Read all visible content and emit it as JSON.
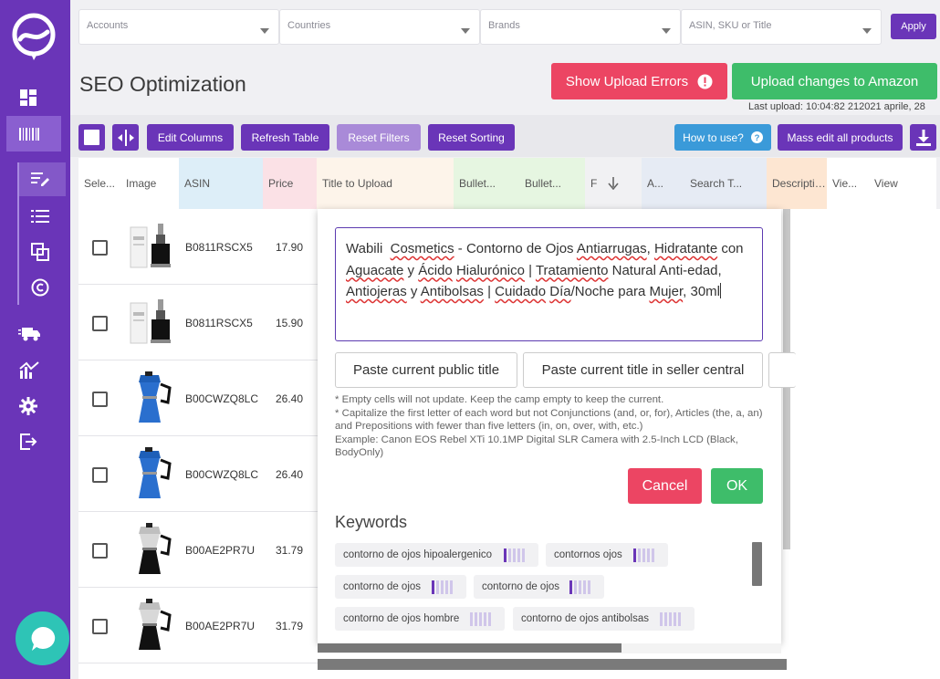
{
  "filters": {
    "accounts": "Accounts",
    "countries": "Countries",
    "brands": "Brands",
    "search": "ASIN, SKU or Title",
    "apply": "Apply"
  },
  "page": {
    "title": "SEO Optimization",
    "show_upload_errors": "Show Upload Errors",
    "upload_changes": "Upload changes to Amazon",
    "last_upload": "Last upload: 10:04:82 212021 aprile, 28"
  },
  "toolbar": {
    "edit_columns": "Edit Columns",
    "refresh_table": "Refresh Table",
    "reset_filters": "Reset Filters",
    "reset_sorting": "Reset Sorting",
    "how_to_use": "How to use?",
    "mass_edit": "Mass edit all products"
  },
  "columns": [
    "Sele...",
    "Image",
    "ASIN",
    "Price",
    "Title to Upload",
    "Bullet...",
    "Bullet...",
    "F",
    "A...",
    "Search T...",
    "Description",
    "Vie...",
    "View"
  ],
  "rows": [
    {
      "asin": "B0811RSCX5",
      "price": "17.90",
      "img": "cosmetic-bottle-image"
    },
    {
      "asin": "B0811RSCX5",
      "price": "15.90",
      "img": "cosmetic-bottle-image"
    },
    {
      "asin": "B00CWZQ8LC",
      "price": "26.40",
      "img": "blue-coffee-maker-image"
    },
    {
      "asin": "B00CWZQ8LC",
      "price": "26.40",
      "img": "blue-coffee-maker-image"
    },
    {
      "asin": "B00AE2PR7U",
      "price": "31.79",
      "img": "steel-coffee-maker-image"
    },
    {
      "asin": "B00AE2PR7U",
      "price": "31.79",
      "img": "steel-coffee-maker-image"
    }
  ],
  "editor": {
    "title_text": "Wabili  Cosmetics - Contorno de Ojos Antiarrugas, Hidratante con Aguacate y Ácido Hialurónico | Tratamiento Natural Anti-edad, Antiojeras y Antibolsas | Cuidado Día/Noche para Mujer, 30ml",
    "paste_public": "Paste current public title",
    "paste_seller": "Paste current title in seller central",
    "note1": "* Empty cells will not update. Keep the camp empty to keep the current.",
    "note2": "* Capitalize the first letter of each word but not Conjunctions (and, or, for), Articles (the, a, an) and Prepositions with fewer than five letters (in, on, over, with, etc.)",
    "note3": "Example: Canon EOS Rebel XTi 10.1MP Digital SLR Camera with 2.5-Inch LCD (Black, BodyOnly)",
    "cancel": "Cancel",
    "ok": "OK",
    "keywords_title": "Keywords",
    "keywords": [
      {
        "text": "contorno de ojos hipoalergenico",
        "level": 1
      },
      {
        "text": "contornos ojos",
        "level": 1
      },
      {
        "text": "contorno de ojos",
        "level": 1
      },
      {
        "text": "contorno de ojos",
        "level": 1
      },
      {
        "text": "contorno de ojos hombre",
        "level": 0
      },
      {
        "text": "contorno de ojos antibolsas",
        "level": 0
      }
    ]
  },
  "colors": {
    "sidebar": "#6a35b8",
    "accent_purple": "#6a35b8",
    "danger": "#ec4563",
    "success": "#3ebd6a",
    "info": "#3a9ad9",
    "chat": "#2ec4b6"
  }
}
